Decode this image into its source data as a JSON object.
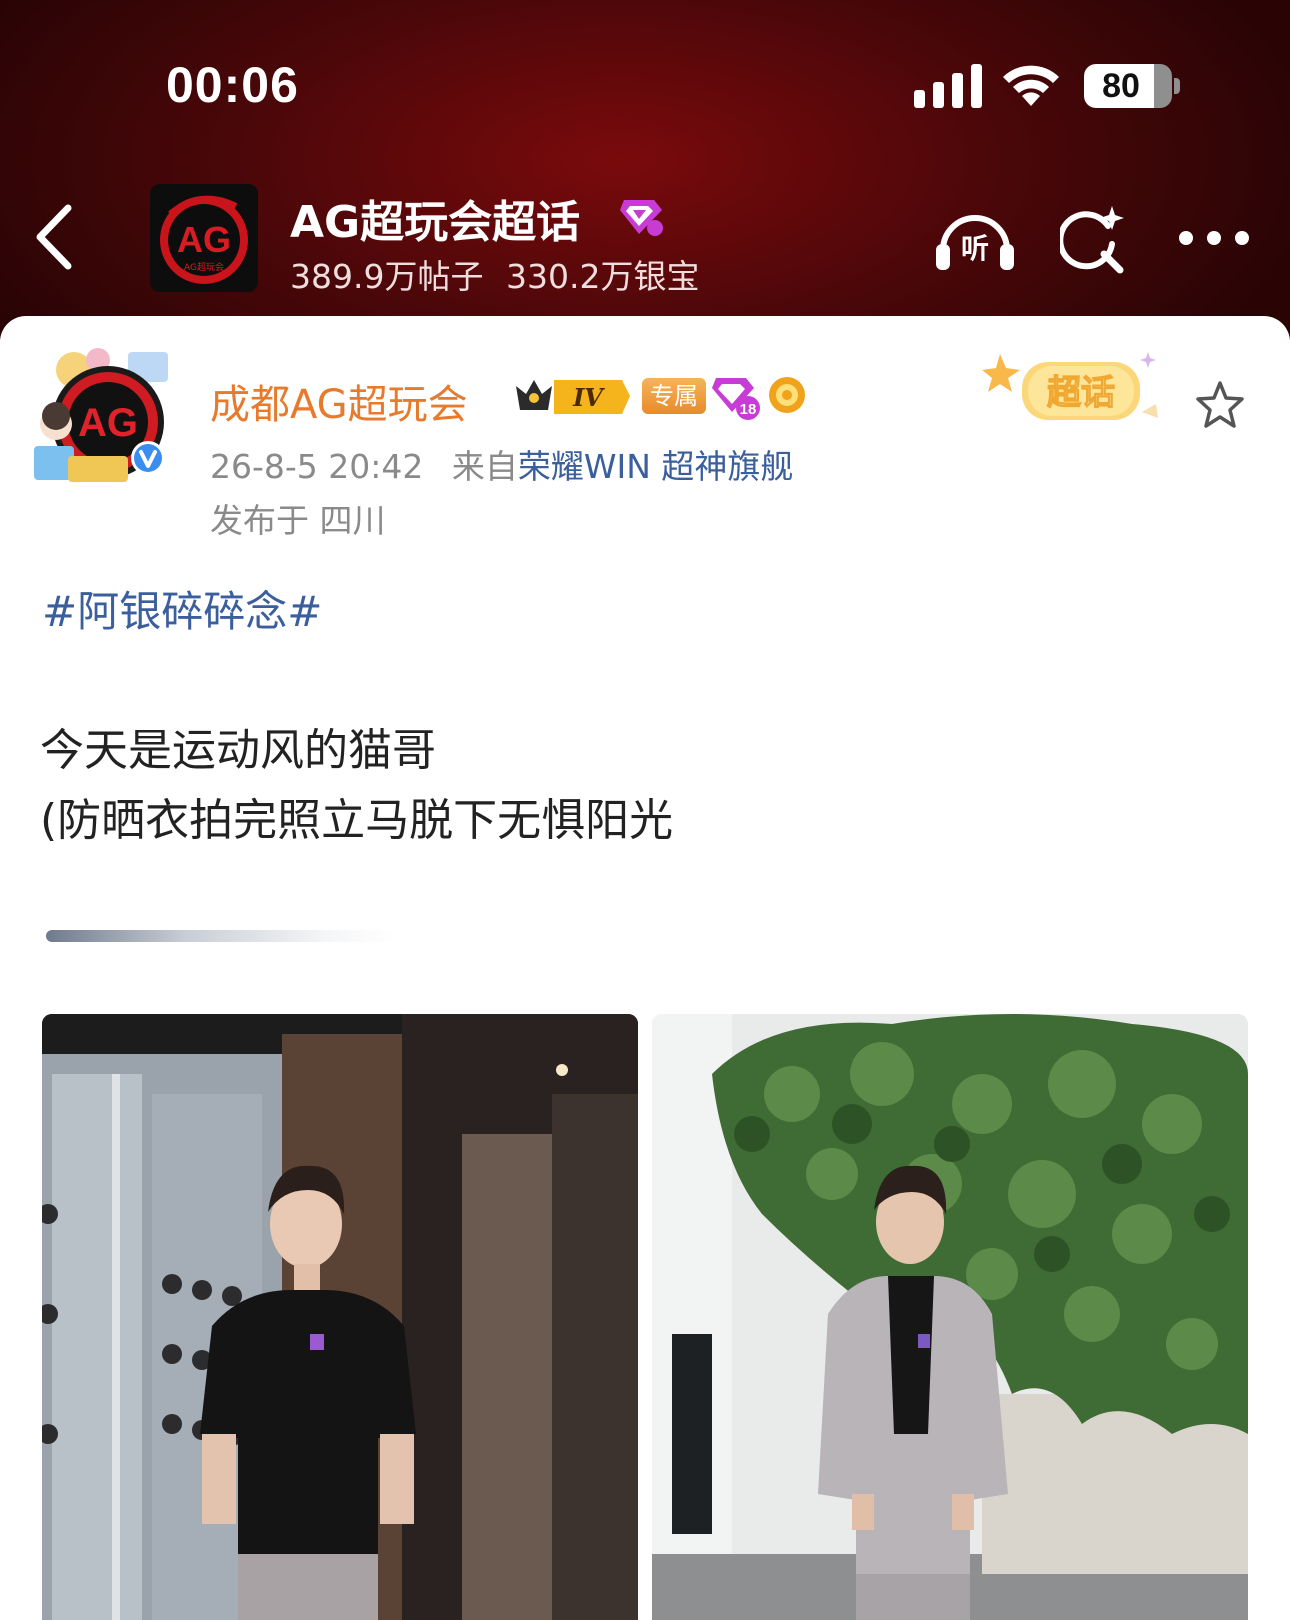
{
  "status_bar": {
    "time": "00:06",
    "battery": "80",
    "battery_level": 0.8
  },
  "topic_header": {
    "title": "AG超玩会超话",
    "posts": "389.9万帖子",
    "silver": "330.2万银宝",
    "listen_label": "听",
    "avatar_text": "AG",
    "avatar_subtext": "AG超玩会"
  },
  "post": {
    "author": "成都AG超玩会",
    "crown_level": "IV",
    "exclusive_badge": "专属",
    "gem_level": "18",
    "timestamp": "26-8-5 20:42",
    "source_prefix": "来自",
    "source": "荣耀WIN 超神旗舰",
    "location": "发布于 四川",
    "sticker_label": "超话",
    "hashtag": "#阿银碎碎念#",
    "lines": [
      "今天是运动风的猫哥",
      "(防晒衣拍完照立马脱下无惧阳光"
    ]
  },
  "icons": {
    "back": "back-icon",
    "listen": "headphones-icon",
    "ai_search": "ai-search-icon",
    "more": "more-icon",
    "favorite": "star-icon",
    "verified": "verified-icon"
  },
  "colors": {
    "header_red": "#6a0a0c",
    "author_orange": "#e87a2c",
    "link_blue": "#3b5f9c"
  }
}
